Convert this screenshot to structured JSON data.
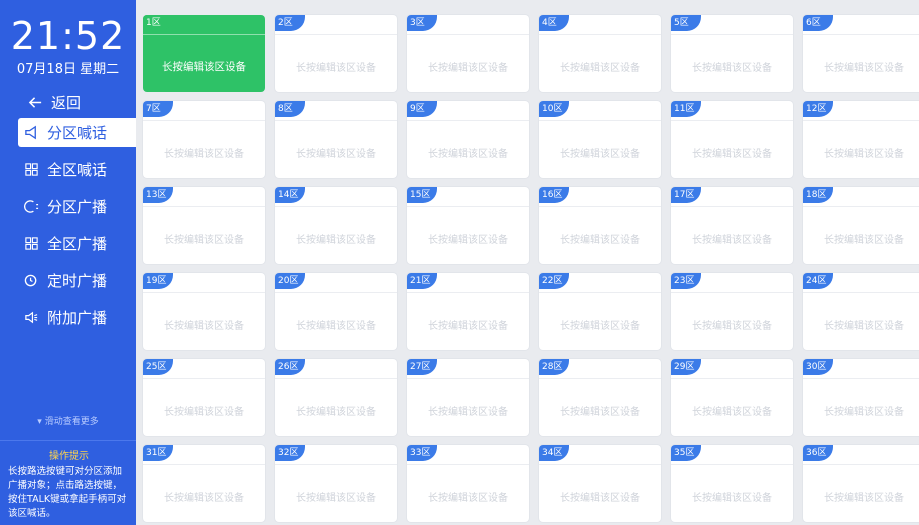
{
  "clock": {
    "time": "21:52",
    "date": "07月18日 星期二"
  },
  "nav": {
    "back": "返回",
    "items": [
      {
        "label": "分区喊话",
        "icon": "megaphone-icon",
        "active": true
      },
      {
        "label": "全区喊话",
        "icon": "grid-icon",
        "active": false
      },
      {
        "label": "分区广播",
        "icon": "broadcast-icon",
        "active": false
      },
      {
        "label": "全区广播",
        "icon": "grid-icon",
        "active": false
      },
      {
        "label": "定时广播",
        "icon": "clock-icon",
        "active": false
      },
      {
        "label": "附加广播",
        "icon": "speaker-icon",
        "active": false
      }
    ]
  },
  "scroll_more": "滑动查看更多",
  "hint": {
    "title": "操作提示",
    "text": "长按路选按键可对分区添加广播对象；点击路选按键，按住TALK键或拿起手柄可对该区喊话。"
  },
  "zones": {
    "edit_label": "长按编辑该区设备",
    "active_index": 0,
    "names": [
      "1区",
      "2区",
      "3区",
      "4区",
      "5区",
      "6区",
      "7区",
      "8区",
      "9区",
      "10区",
      "11区",
      "12区",
      "13区",
      "14区",
      "15区",
      "16区",
      "17区",
      "18区",
      "19区",
      "20区",
      "21区",
      "22区",
      "23区",
      "24区",
      "25区",
      "26区",
      "27区",
      "28区",
      "29区",
      "30区",
      "31区",
      "32区",
      "33区",
      "34区",
      "35区",
      "36区"
    ]
  },
  "colors": {
    "sidebar": "#2f5fe0",
    "active_card": "#2ec267",
    "tag": "#3b7be8",
    "hint_title": "#ffd54a"
  }
}
